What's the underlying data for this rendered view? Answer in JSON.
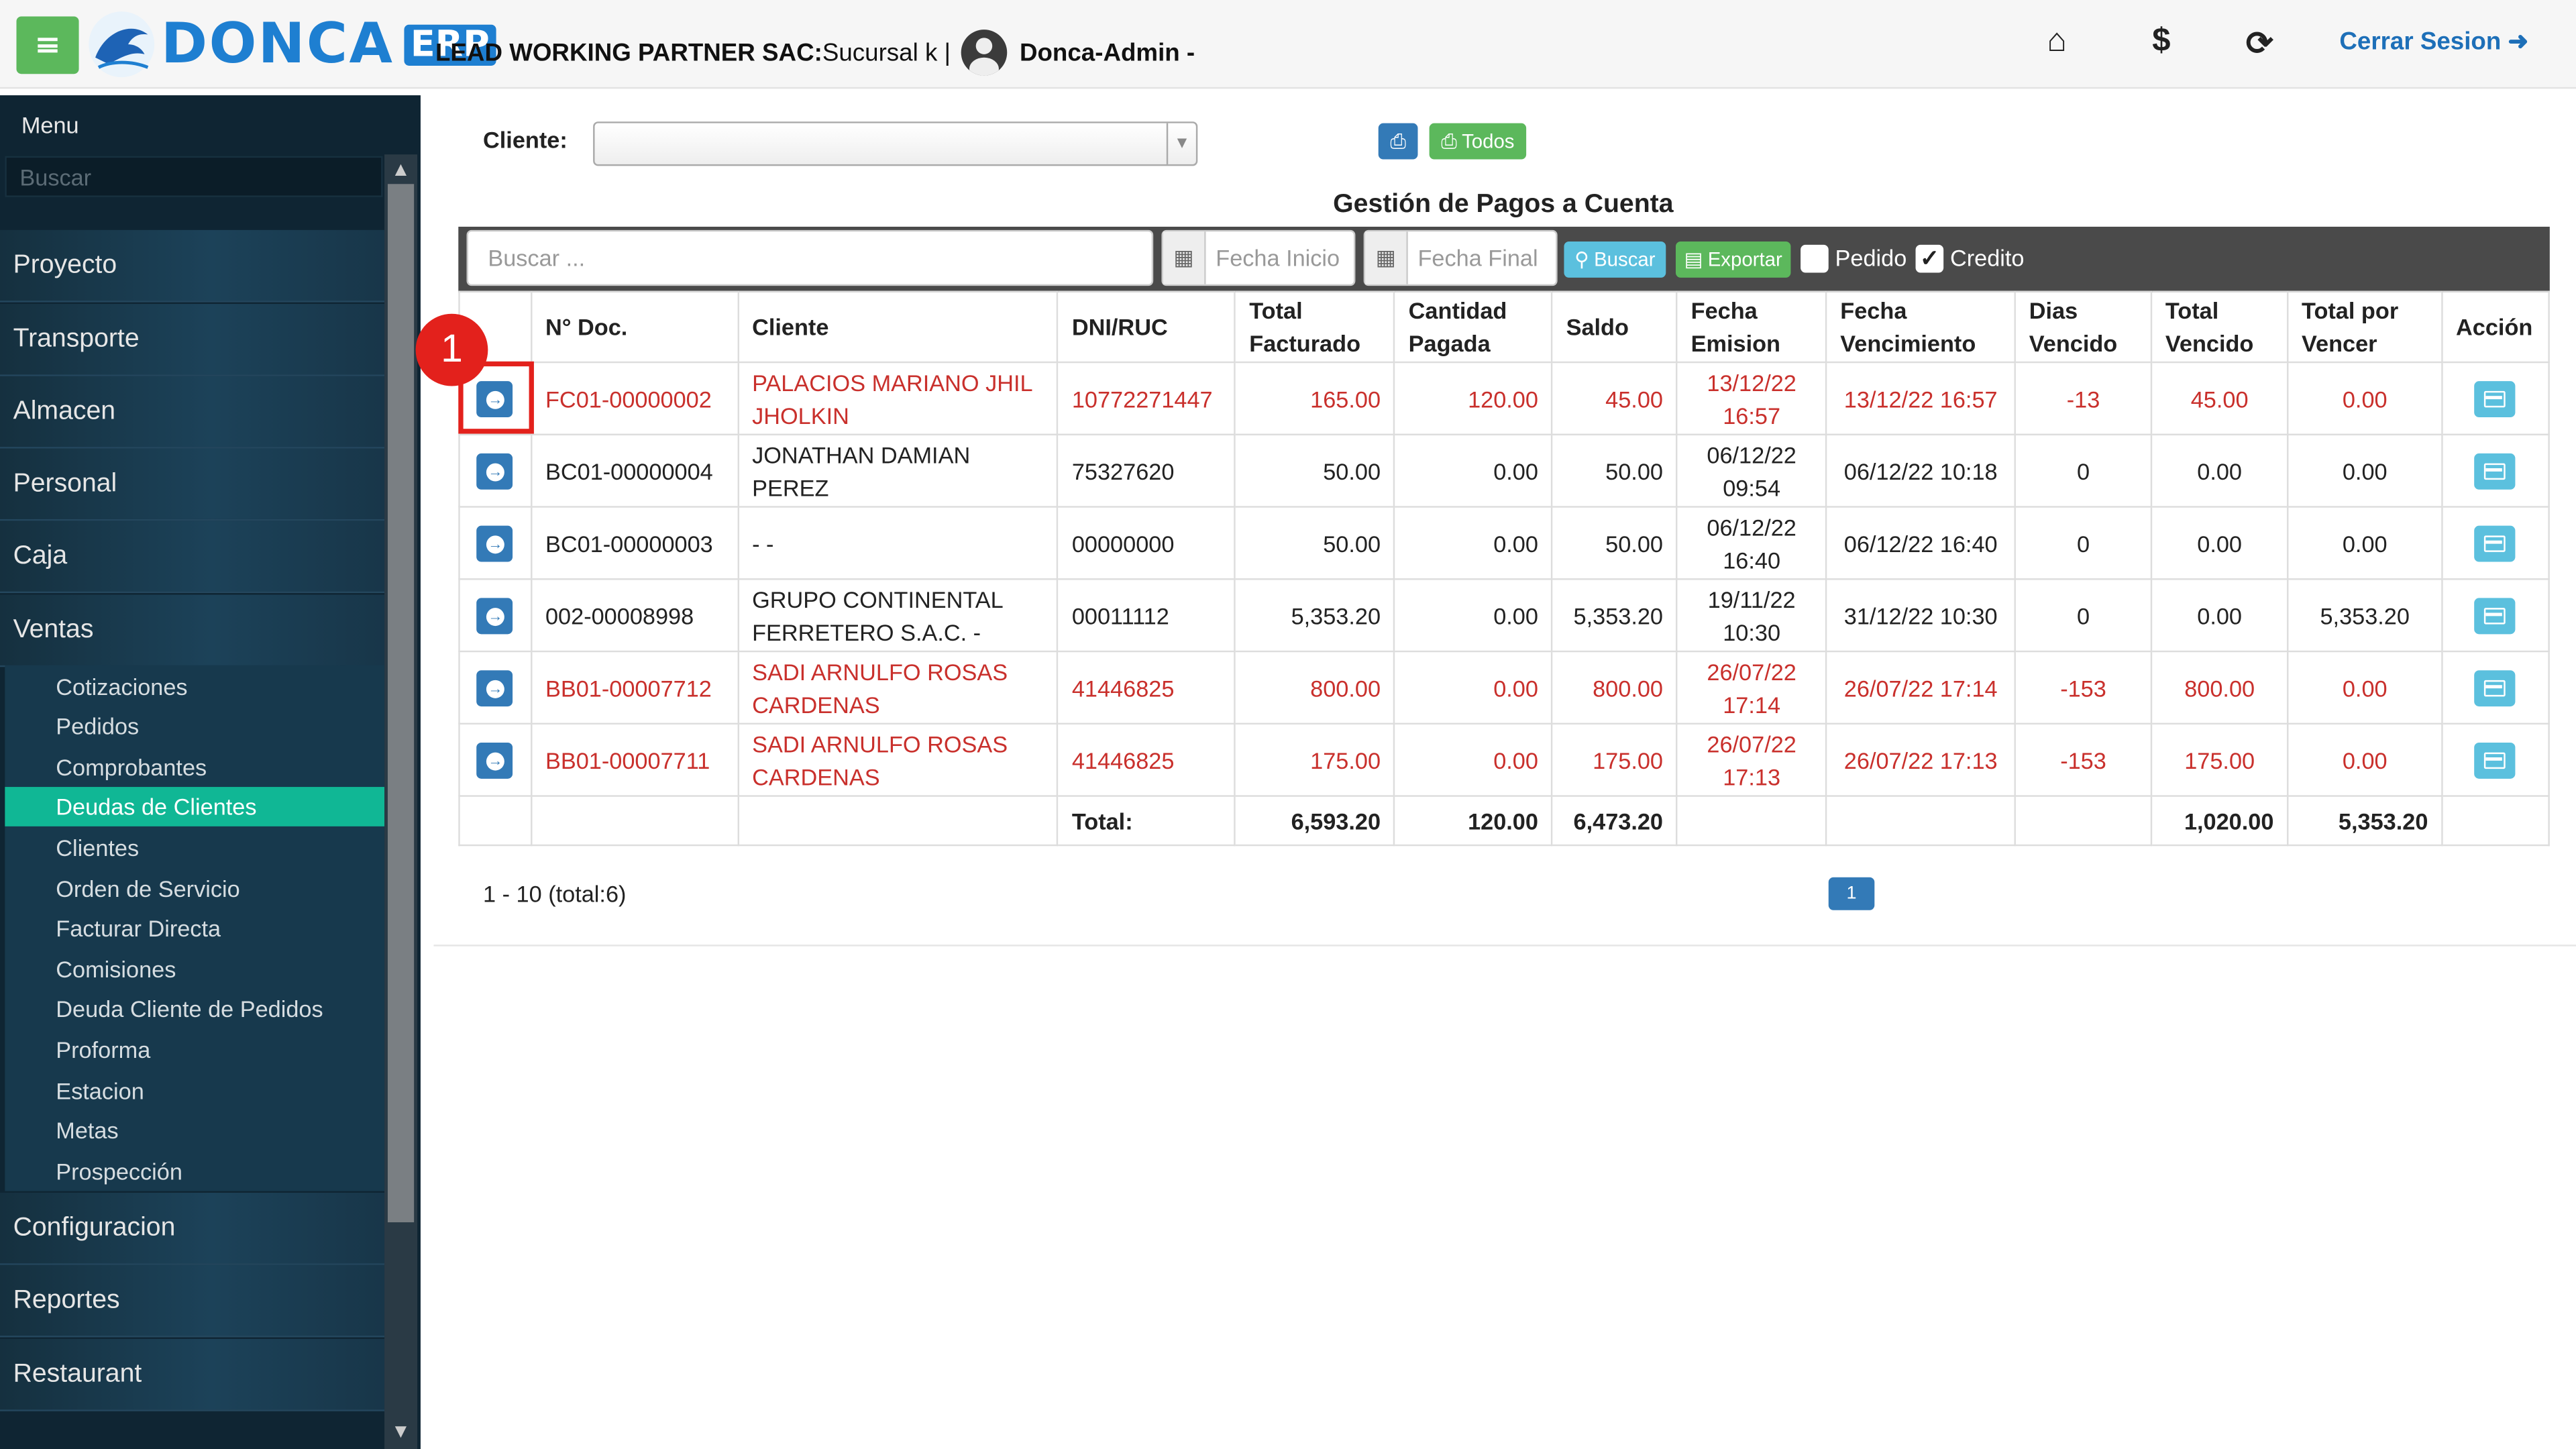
{
  "header": {
    "logo_text": "DONCA",
    "logo_badge": "ERP",
    "company_bold": "LEAD WORKING PARTNER SAC:",
    "company_rest": " Sucursal k |",
    "user": "Donca-Admin -",
    "logout_label": "Cerrar Sesion",
    "icons": [
      "home-icon",
      "dollar-icon",
      "sync-icon",
      "logout-icon"
    ]
  },
  "sidebar": {
    "menu_title": "Menu",
    "search_placeholder": "Buscar",
    "items": [
      {
        "label": "Proyecto"
      },
      {
        "label": "Transporte"
      },
      {
        "label": "Almacen"
      },
      {
        "label": "Personal"
      },
      {
        "label": "Caja"
      },
      {
        "label": "Ventas"
      }
    ],
    "ventas_sub": [
      {
        "label": "Cotizaciones"
      },
      {
        "label": "Pedidos"
      },
      {
        "label": "Comprobantes"
      },
      {
        "label": "Deudas de Clientes",
        "active": true
      },
      {
        "label": "Clientes"
      },
      {
        "label": "Orden de Servicio"
      },
      {
        "label": "Facturar Directa"
      },
      {
        "label": "Comisiones"
      },
      {
        "label": "Deuda Cliente de Pedidos"
      },
      {
        "label": "Proforma"
      },
      {
        "label": "Estacion"
      },
      {
        "label": "Metas"
      },
      {
        "label": "Prospección"
      }
    ],
    "bottom_items": [
      {
        "label": "Configuracion"
      },
      {
        "label": "Reportes"
      },
      {
        "label": "Restaurant"
      }
    ]
  },
  "filters": {
    "cliente_label": "Cliente:",
    "todos_label": "Todos"
  },
  "page_title": "Gestión de Pagos a Cuenta",
  "toolbar": {
    "search_placeholder": "Buscar ...",
    "fecha_inicio_placeholder": "Fecha Inicio",
    "fecha_final_placeholder": "Fecha Final",
    "buscar_label": "Buscar",
    "exportar_label": "Exportar",
    "pedido_label": "Pedido",
    "pedido_checked": false,
    "credito_label": "Credito",
    "credito_checked": true
  },
  "table": {
    "headers": [
      "",
      "N° Doc.",
      "Cliente",
      "DNI/RUC",
      "Total Facturado",
      "Cantidad Pagada",
      "Saldo",
      "Fecha Emision",
      "Fecha Vencimiento",
      "Dias Vencido",
      "Total Vencido",
      "Total por Vencer",
      "Acción"
    ],
    "rows": [
      {
        "doc": "FC01-00000002",
        "cliente": "PALACIOS MARIANO JHIL JHOLKIN",
        "dni": "10772271447",
        "total_facturado": "165.00",
        "cantidad_pagada": "120.00",
        "saldo": "45.00",
        "fecha_emision": "13/12/22 16:57",
        "fecha_vencimiento": "13/12/22 16:57",
        "dias_vencido": "-13",
        "total_vencido": "45.00",
        "total_por_vencer": "0.00",
        "overdue": true
      },
      {
        "doc": "BC01-00000004",
        "cliente": "JONATHAN DAMIAN PEREZ",
        "dni": "75327620",
        "total_facturado": "50.00",
        "cantidad_pagada": "0.00",
        "saldo": "50.00",
        "fecha_emision": "06/12/22 09:54",
        "fecha_vencimiento": "06/12/22 10:18",
        "dias_vencido": "0",
        "total_vencido": "0.00",
        "total_por_vencer": "0.00",
        "overdue": false
      },
      {
        "doc": "BC01-00000003",
        "cliente": "- -",
        "dni": "00000000",
        "total_facturado": "50.00",
        "cantidad_pagada": "0.00",
        "saldo": "50.00",
        "fecha_emision": "06/12/22 16:40",
        "fecha_vencimiento": "06/12/22 16:40",
        "dias_vencido": "0",
        "total_vencido": "0.00",
        "total_por_vencer": "0.00",
        "overdue": false
      },
      {
        "doc": "002-00008998",
        "cliente": "GRUPO CONTINENTAL FERRETERO S.A.C. -",
        "dni": "00011112",
        "total_facturado": "5,353.20",
        "cantidad_pagada": "0.00",
        "saldo": "5,353.20",
        "fecha_emision": "19/11/22 10:30",
        "fecha_vencimiento": "31/12/22 10:30",
        "dias_vencido": "0",
        "total_vencido": "0.00",
        "total_por_vencer": "5,353.20",
        "overdue": false
      },
      {
        "doc": "BB01-00007712",
        "cliente": "SADI ARNULFO ROSAS CARDENAS",
        "dni": "41446825",
        "total_facturado": "800.00",
        "cantidad_pagada": "0.00",
        "saldo": "800.00",
        "fecha_emision": "26/07/22 17:14",
        "fecha_vencimiento": "26/07/22 17:14",
        "dias_vencido": "-153",
        "total_vencido": "800.00",
        "total_por_vencer": "0.00",
        "overdue": true
      },
      {
        "doc": "BB01-00007711",
        "cliente": "SADI ARNULFO ROSAS CARDENAS",
        "dni": "41446825",
        "total_facturado": "175.00",
        "cantidad_pagada": "0.00",
        "saldo": "175.00",
        "fecha_emision": "26/07/22 17:13",
        "fecha_vencimiento": "26/07/22 17:13",
        "dias_vencido": "-153",
        "total_vencido": "175.00",
        "total_por_vencer": "0.00",
        "overdue": true
      }
    ],
    "totals": {
      "label": "Total:",
      "total_facturado": "6,593.20",
      "cantidad_pagada": "120.00",
      "saldo": "6,473.20",
      "total_vencido": "1,020.00",
      "total_por_vencer": "5,353.20"
    }
  },
  "pagination": {
    "info": "1 - 10 (total:6)",
    "current_page": "1"
  },
  "annotation": {
    "step": "1"
  },
  "colors": {
    "overdue_text": "#c9302c",
    "active_menu": "#10b795",
    "primary": "#337ab7",
    "success": "#5cb85c",
    "info": "#5bc0de",
    "annotation": "#e3211c"
  }
}
